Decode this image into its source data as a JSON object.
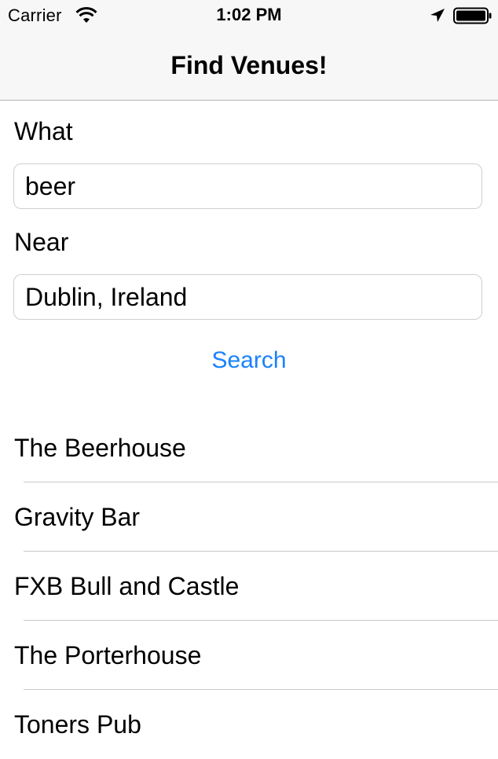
{
  "status_bar": {
    "carrier": "Carrier",
    "time": "1:02 PM",
    "icons": [
      "wifi-icon",
      "location-arrow-icon",
      "battery-icon"
    ]
  },
  "nav": {
    "title": "Find Venues!"
  },
  "form": {
    "what_label": "What",
    "what_value": "beer",
    "near_label": "Near",
    "near_value": "Dublin, Ireland",
    "search_label": "Search"
  },
  "colors": {
    "accent": "#1a82fb",
    "bar_background": "#f7f7f7",
    "separator": "#c8c7cc"
  },
  "results": [
    "The Beerhouse",
    "Gravity Bar",
    "FXB Bull and Castle",
    "The Porterhouse",
    "Toners Pub"
  ]
}
